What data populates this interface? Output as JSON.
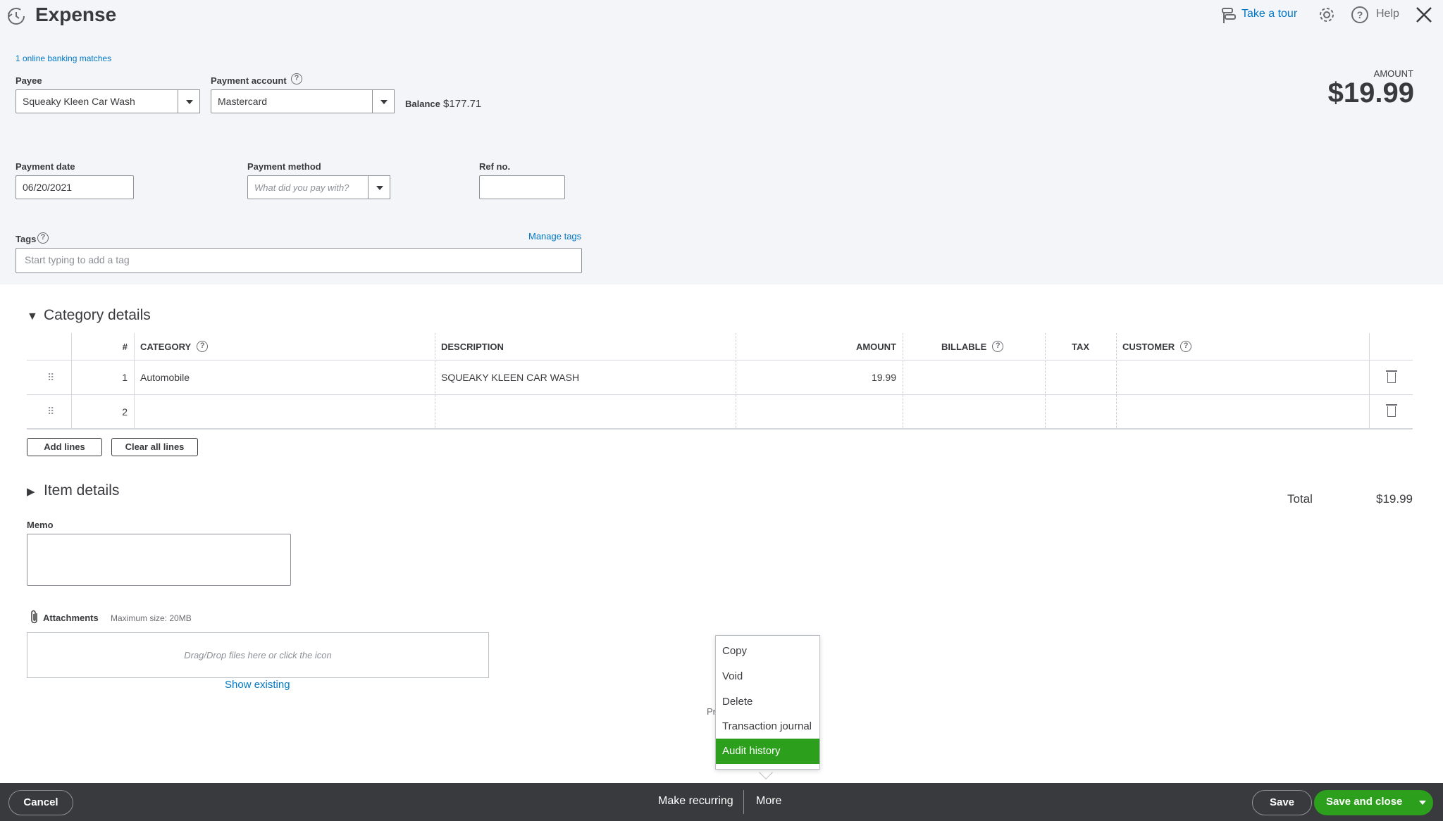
{
  "header": {
    "title": "Expense",
    "take_tour": "Take a tour",
    "help": "Help"
  },
  "banking_matches": "1 online banking matches",
  "payee": {
    "label": "Payee",
    "value": "Squeaky Kleen Car Wash"
  },
  "payment_account": {
    "label": "Payment account",
    "value": "Mastercard",
    "balance_label": "Balance",
    "balance_value": "$177.71"
  },
  "amount": {
    "label": "AMOUNT",
    "value": "$19.99"
  },
  "payment_date": {
    "label": "Payment date",
    "value": "06/20/2021"
  },
  "payment_method": {
    "label": "Payment method",
    "placeholder": "What did you pay with?"
  },
  "ref_no": {
    "label": "Ref no.",
    "value": ""
  },
  "tags": {
    "label": "Tags",
    "manage": "Manage tags",
    "placeholder": "Start typing to add a tag"
  },
  "category_details": {
    "title": "Category details",
    "columns": [
      "#",
      "CATEGORY",
      "DESCRIPTION",
      "AMOUNT",
      "BILLABLE",
      "TAX",
      "CUSTOMER"
    ],
    "rows": [
      {
        "num": "1",
        "category": "Automobile",
        "description": "SQUEAKY KLEEN CAR WASH",
        "amount": "19.99",
        "billable": "",
        "tax": "",
        "customer": ""
      },
      {
        "num": "2",
        "category": "",
        "description": "",
        "amount": "",
        "billable": "",
        "tax": "",
        "customer": ""
      }
    ],
    "add_lines": "Add lines",
    "clear_lines": "Clear all lines"
  },
  "item_details": {
    "title": "Item details"
  },
  "total": {
    "label": "Total",
    "value": "$19.99"
  },
  "memo": {
    "label": "Memo",
    "value": ""
  },
  "attachments": {
    "label": "Attachments",
    "max_size": "Maximum size: 20MB",
    "drop_text": "Drag/Drop files here or click the icon",
    "show_existing": "Show existing"
  },
  "partial_text": "Pr",
  "more_menu": {
    "items": [
      "Copy",
      "Void",
      "Delete",
      "Transaction journal",
      "Audit history"
    ],
    "highlighted": "Audit history"
  },
  "footer": {
    "cancel": "Cancel",
    "make_recurring": "Make recurring",
    "more": "More",
    "save": "Save",
    "save_close": "Save and close"
  },
  "colors": {
    "accent_green": "#2ca01c",
    "link_blue": "#0077c5",
    "footer_bg": "#393a3d"
  }
}
